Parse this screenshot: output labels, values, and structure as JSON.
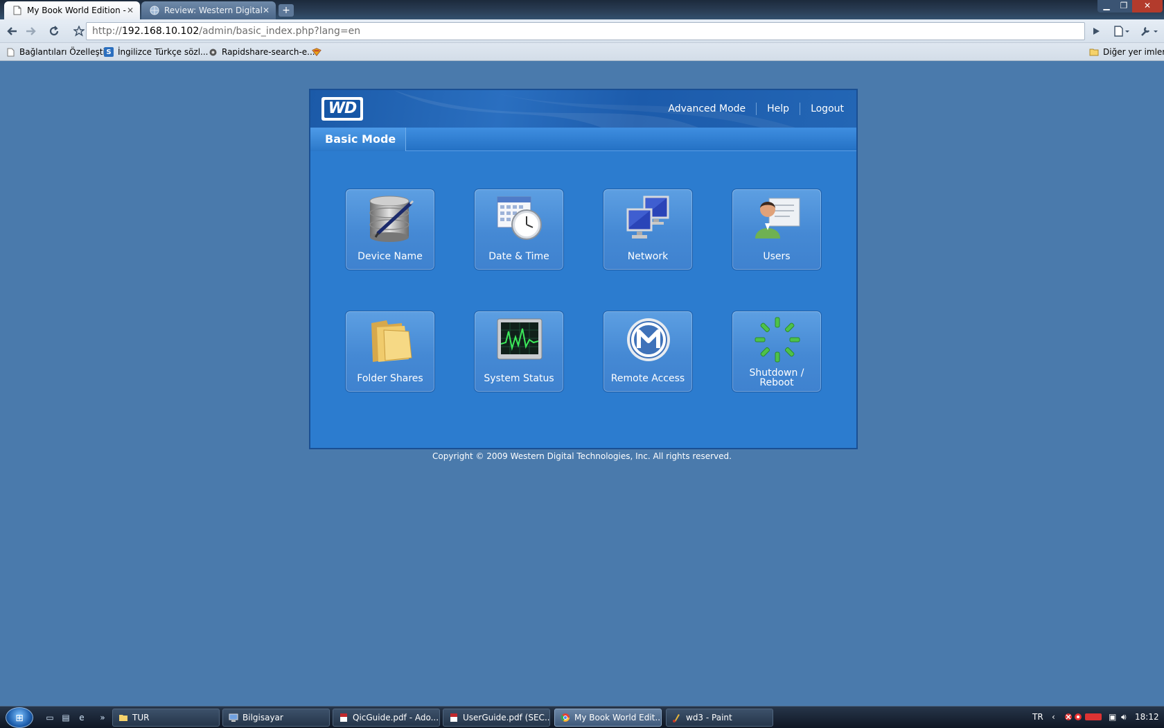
{
  "browser": {
    "tabs": [
      {
        "title": "My Book World Edition - ...",
        "active": true
      },
      {
        "title": "Review: Western Digital ...",
        "active": false
      }
    ],
    "new_tab_label": "+",
    "address": {
      "scheme": "http://",
      "host": "192.168.10.102",
      "path": "/admin/basic_index.php?lang=en"
    },
    "bookmarks": [
      {
        "label": "Bağlantıları Özelleştir",
        "icon": "page-icon"
      },
      {
        "label": "İngilizce Türkçe sözl...",
        "icon": "s-icon"
      },
      {
        "label": "Rapidshare-search-e...",
        "icon": "gear-icon"
      },
      {
        "label": "",
        "icon": "bookmark-extra-icon"
      }
    ],
    "other_bookmarks": "Diğer yer imleri"
  },
  "wd": {
    "logo_text": "WD",
    "nav": {
      "advanced": "Advanced Mode",
      "help": "Help",
      "logout": "Logout"
    },
    "mode_tab": "Basic Mode",
    "tiles": [
      {
        "label": "Device Name",
        "icon": "database-pen-icon"
      },
      {
        "label": "Date & Time",
        "icon": "calendar-clock-icon"
      },
      {
        "label": "Network",
        "icon": "network-computers-icon"
      },
      {
        "label": "Users",
        "icon": "user-icon"
      },
      {
        "label": "Folder Shares",
        "icon": "folder-icon"
      },
      {
        "label": "System Status",
        "icon": "monitor-graph-icon"
      },
      {
        "label": "Remote Access",
        "icon": "mionet-icon"
      },
      {
        "label": "Shutdown /",
        "label2": "Reboot",
        "icon": "spinner-icon"
      }
    ],
    "copyright": "Copyright © 2009 Western Digital Technologies, Inc. All rights reserved."
  },
  "taskbar": {
    "tasks": [
      {
        "label": "TUR",
        "icon": "folder-icon",
        "active": false
      },
      {
        "label": "Bilgisayar",
        "icon": "computer-icon",
        "active": false
      },
      {
        "label": "QicGuide.pdf - Ado...",
        "icon": "pdf-icon",
        "active": false
      },
      {
        "label": "UserGuide.pdf (SEC...",
        "icon": "pdf-icon",
        "active": false
      },
      {
        "label": "My Book World Edit...",
        "icon": "chrome-icon",
        "active": true
      },
      {
        "label": "wd3 - Paint",
        "icon": "paint-icon",
        "active": false
      }
    ],
    "language": "TR",
    "clock": "18:12"
  }
}
